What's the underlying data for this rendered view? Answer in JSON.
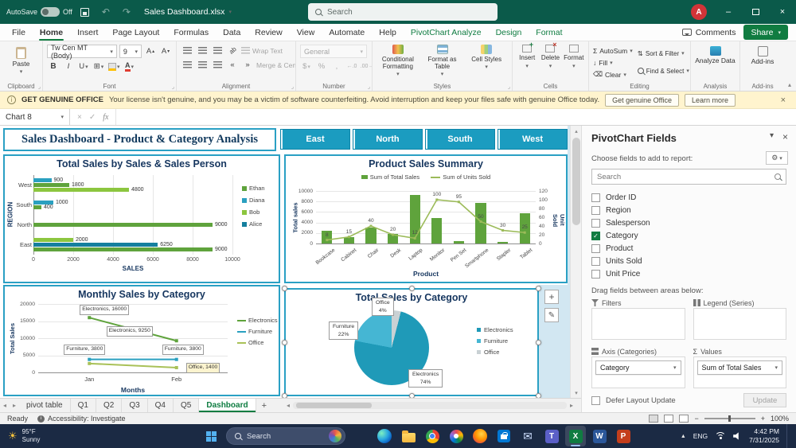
{
  "titlebar": {
    "autosave_label": "AutoSave",
    "autosave_state": "Off",
    "doc_title": "Sales Dashboard.xlsx",
    "search_placeholder": "Search",
    "avatar_initial": "A"
  },
  "ribbon": {
    "tabs": [
      "File",
      "Home",
      "Insert",
      "Page Layout",
      "Formulas",
      "Data",
      "Review",
      "View",
      "Automate",
      "Help",
      "PivotChart Analyze",
      "Design",
      "Format"
    ],
    "active_tab": "Home",
    "contextual_tabs": [
      "PivotChart Analyze",
      "Design",
      "Format"
    ],
    "comments_label": "Comments",
    "share_label": "Share",
    "paste_label": "Paste",
    "font_name": "Tw Cen MT (Body)",
    "font_size": "9",
    "wrap_text": "Wrap Text",
    "merge_center": "Merge & Center",
    "number_format": "General",
    "styles_buttons": [
      "Conditional Formatting",
      "Format as Table",
      "Cell Styles"
    ],
    "cells_buttons": [
      "Insert",
      "Delete",
      "Format"
    ],
    "editing": {
      "autosum": "AutoSum",
      "fill": "Fill",
      "clear": "Clear",
      "sort_filter": "Sort & Filter",
      "find_select": "Find & Select"
    },
    "analyze_label": "Analyze Data",
    "addins_label": "Add-ins",
    "group_labels": [
      "Clipboard",
      "Font",
      "Alignment",
      "Number",
      "Styles",
      "Cells",
      "Editing",
      "Analysis",
      "Add-ins"
    ]
  },
  "warning_bar": {
    "badge": "GET GENUINE OFFICE",
    "message": "Your license isn't genuine, and you may be a victim of software counterfeiting. Avoid interruption and keep your files safe with genuine Office today.",
    "primary_button": "Get genuine Office",
    "secondary_button": "Learn more"
  },
  "formula_bar": {
    "name_box": "Chart 8",
    "fx_label": "fx"
  },
  "dashboard": {
    "title": "Sales Dashboard - Product & Category Analysis",
    "slicers": [
      "East",
      "North",
      "South",
      "West"
    ]
  },
  "chart_data": [
    {
      "id": "total-sales-by-salesperson",
      "type": "bar",
      "orientation": "horizontal",
      "title": "Total Sales by Sales & Sales Person",
      "xlabel": "SALES",
      "ylabel": "REGION",
      "xlim": [
        0,
        10000
      ],
      "xticks": [
        0,
        2000,
        4000,
        6000,
        8000,
        10000
      ],
      "legend": [
        "Ethan",
        "Diana",
        "Bob",
        "Alice"
      ],
      "legend_colors": [
        "#5fa33c",
        "#2aa0c0",
        "#8cc63f",
        "#157f9e"
      ],
      "groups": [
        {
          "category": "West",
          "bars": [
            {
              "value": 900,
              "label": "900",
              "color": "#2aa0c0"
            },
            {
              "value": 1800,
              "label": "1800",
              "color": "#5fa33c"
            },
            {
              "value": 4800,
              "label": "4800",
              "color": "#8cc63f"
            }
          ]
        },
        {
          "category": "South",
          "bars": [
            {
              "value": 1000,
              "label": "1000",
              "color": "#2aa0c0"
            },
            {
              "value": 400,
              "label": "400",
              "color": "#5fa33c"
            }
          ]
        },
        {
          "category": "North",
          "bars": [
            {
              "value": 9000,
              "label": "9000",
              "color": "#5fa33c"
            }
          ]
        },
        {
          "category": "East",
          "bars": [
            {
              "value": 2000,
              "label": "2000",
              "color": "#8cc63f"
            },
            {
              "value": 6250,
              "label": "6250",
              "color": "#157f9e"
            },
            {
              "value": 9000,
              "label": "9000",
              "color": "#5fa33c"
            }
          ]
        }
      ]
    },
    {
      "id": "product-sales-summary",
      "type": "combo",
      "title": "Product Sales Summary",
      "legend": [
        "Sum of Total Sales",
        "Sum of Units Sold"
      ],
      "categories": [
        "Bookcase",
        "Cabinet",
        "Chair",
        "Desk",
        "Laptop",
        "Monitor",
        "Pen Set",
        "Smartphone",
        "Stapler",
        "Tablet"
      ],
      "bar_values": [
        2400,
        1200,
        3000,
        1800,
        9200,
        4800,
        400,
        7800,
        350,
        5800
      ],
      "line_values": [
        8,
        15,
        40,
        20,
        12,
        100,
        95,
        50,
        30,
        25
      ],
      "ylabel_left": "Total sales",
      "ylabel_right": "Unit Sold",
      "xlabel": "Product",
      "ylim_left": [
        0,
        10000
      ],
      "yticks_left": [
        0,
        2000,
        4000,
        6000,
        8000,
        10000
      ],
      "ylim_right": [
        0,
        120
      ],
      "yticks_right": [
        0,
        20,
        40,
        60,
        80,
        100,
        120
      ],
      "bar_color": "#5fa33c",
      "line_color": "#9cbb59"
    },
    {
      "id": "monthly-sales-by-category",
      "type": "line",
      "title": "Monthly Sales by Category",
      "categories": [
        "Jan",
        "Feb"
      ],
      "xlabel": "Months",
      "ylabel": "Total Sales",
      "ylim": [
        0,
        20000
      ],
      "yticks": [
        0,
        5000,
        10000,
        15000,
        20000
      ],
      "series": [
        {
          "name": "Electronics",
          "color": "#5fa33c",
          "values": [
            16000,
            9250
          ],
          "labels": [
            "Electronics, 16000",
            "Electronics, 9250"
          ]
        },
        {
          "name": "Furniture",
          "color": "#2aa0c0",
          "values": [
            3800,
            3800
          ],
          "labels": [
            "Furniture, 3800",
            "Furniture, 3800"
          ]
        },
        {
          "name": "Office",
          "color": "#a9c158",
          "values": [
            2600,
            1400
          ],
          "labels": [
            null,
            "Office, 1400"
          ]
        }
      ]
    },
    {
      "id": "total-sales-by-category",
      "type": "pie",
      "title": "Total Sales by Category",
      "slices": [
        {
          "name": "Office",
          "pct": 4,
          "color": "#c9d1d4"
        },
        {
          "name": "Electronics",
          "pct": 74,
          "color": "#1f9ab8"
        },
        {
          "name": "Furniture",
          "pct": 22,
          "color": "#45b6d3"
        }
      ],
      "legend": [
        "Electronics",
        "Furniture",
        "Office"
      ]
    }
  ],
  "fields_panel": {
    "title": "PivotChart Fields",
    "subtitle": "Choose fields to add to report:",
    "search_placeholder": "Search",
    "fields": [
      {
        "label": "Order ID",
        "checked": false
      },
      {
        "label": "Region",
        "checked": false
      },
      {
        "label": "Salesperson",
        "checked": false
      },
      {
        "label": "Category",
        "checked": true
      },
      {
        "label": "Product",
        "checked": false
      },
      {
        "label": "Units Sold",
        "checked": false
      },
      {
        "label": "Unit Price",
        "checked": false
      }
    ],
    "drag_hint": "Drag fields between areas below:",
    "areas": {
      "filters": "Filters",
      "legend": "Legend (Series)",
      "axis": "Axis (Categories)",
      "values": "Values"
    },
    "axis_item": "Category",
    "values_item": "Sum of Total Sales",
    "defer_label": "Defer Layout Update",
    "update_label": "Update"
  },
  "sheet_tabs": {
    "tabs": [
      "pivot table",
      "Q1",
      "Q2",
      "Q3",
      "Q4",
      "Q5",
      "Dashboard"
    ],
    "active_tab": "Dashboard"
  },
  "status_bar": {
    "ready": "Ready",
    "accessibility": "Accessibility: Investigate",
    "zoom_level": "100%"
  },
  "taskbar": {
    "weather_temp": "95°F",
    "weather_condition": "Sunny",
    "search_placeholder": "Search",
    "icons": [
      "task-view",
      "edge",
      "file-explorer",
      "chrome",
      "photos",
      "firefox",
      "store",
      "mail",
      "teams",
      "excel",
      "word",
      "powerpoint"
    ],
    "active_icon": "excel",
    "language": "ENG",
    "time": "4:42 PM",
    "date": "7/31/2025"
  }
}
